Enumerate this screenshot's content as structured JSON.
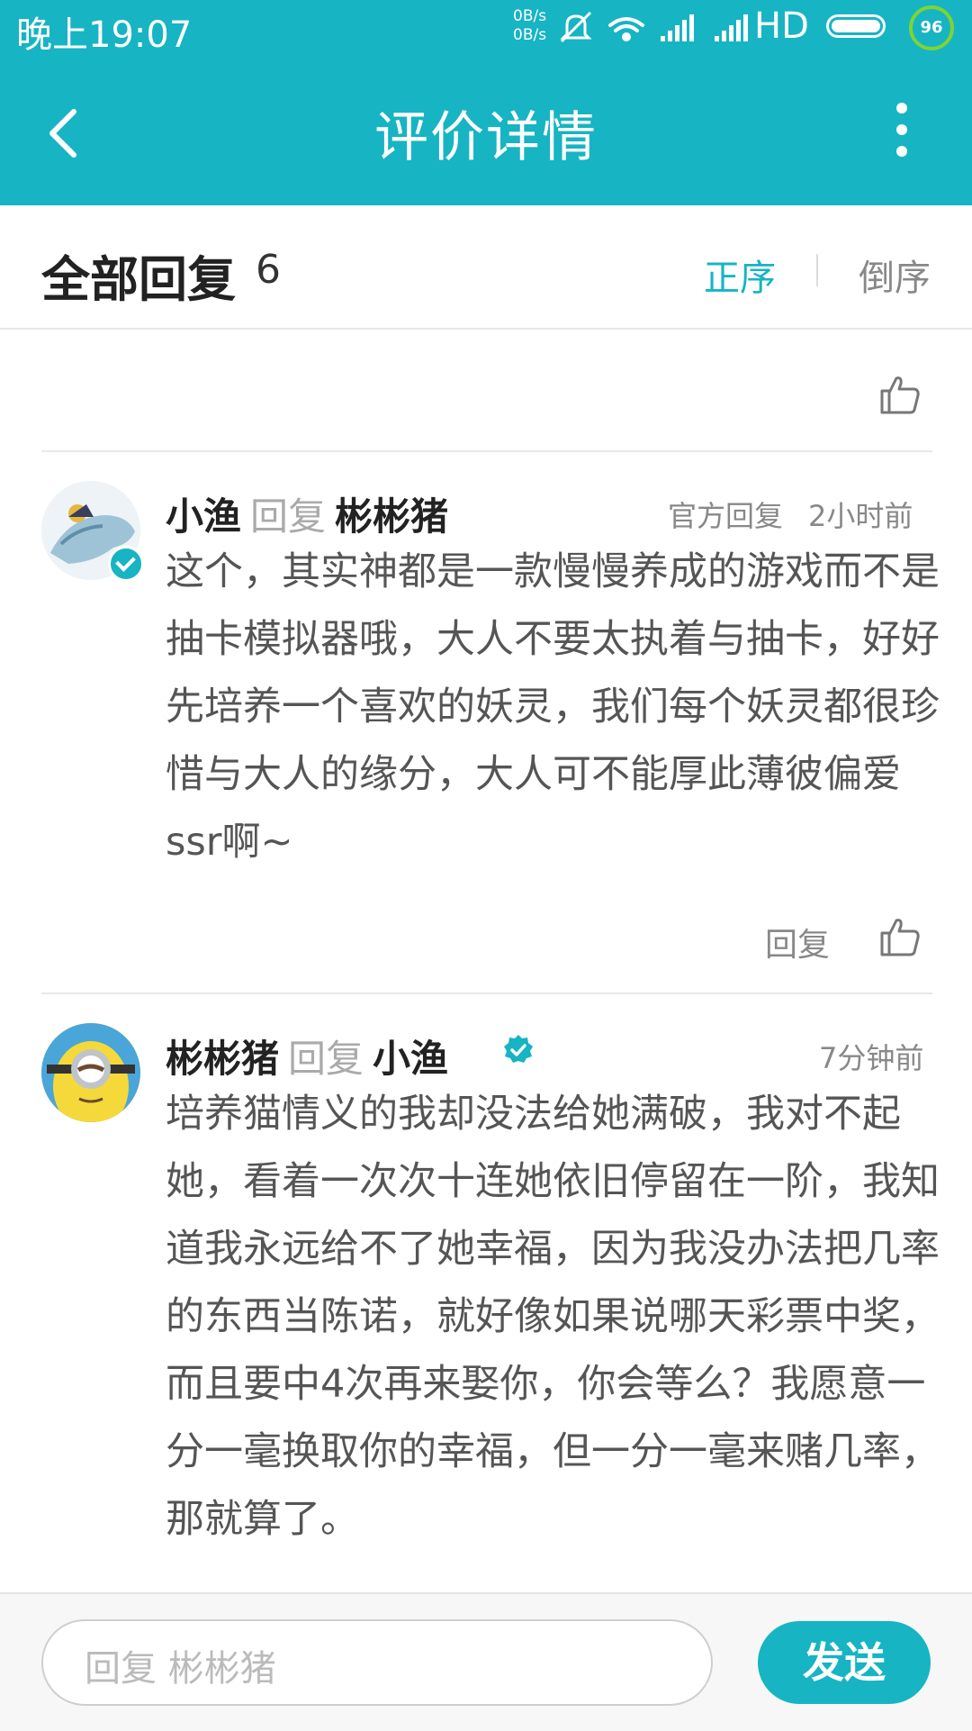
{
  "status_bar": {
    "time": "晚上19:07",
    "net_up": "0B/s",
    "net_down": "0B/s",
    "network": "HD",
    "badge": "96",
    "icons": [
      "mute-icon",
      "wifi-icon",
      "signal-icon",
      "signal-icon",
      "battery-icon"
    ]
  },
  "nav": {
    "title": "评价详情",
    "back_icon": "back-arrow-icon",
    "more_icon": "more-vertical-icon"
  },
  "replies_header": {
    "title": "全部回复",
    "count": "6",
    "sort_asc": "正序",
    "sort_desc": "倒序",
    "active_sort": "正序"
  },
  "comments": [
    {
      "author": "小渔",
      "reply_word": "回复",
      "target": "彬彬猪",
      "tag": "官方回复",
      "time": "2小时前",
      "body": "这个，其实神都是一款慢慢养成的游戏而不是抽卡模拟器哦，大人不要太执着与抽卡，好好先培养一个喜欢的妖灵，我们每个妖灵都很珍惜与大人的缘分，大人可不能厚此薄彼偏爱ssr啊~",
      "reply_action": "回复"
    },
    {
      "author": "彬彬猪",
      "reply_word": "回复",
      "target": "小渔",
      "time": "7分钟前",
      "body": "培养猫情义的我却没法给她满破，我对不起她，看着一次次十连她依旧停留在一阶，我知道我永远给不了她幸福，因为我没办法把几率的东西当陈诺，就好像如果说哪天彩票中奖，而且要中4次再来娶你，你会等么？我愿意一分一毫换取你的幸福，但一分一毫来赌几率，那就算了。"
    }
  ],
  "composer": {
    "placeholder": "回复 彬彬猪",
    "send_label": "发送"
  },
  "colors": {
    "accent": "#17b4c3",
    "text_dark": "#222222",
    "text_muted": "#888888"
  }
}
